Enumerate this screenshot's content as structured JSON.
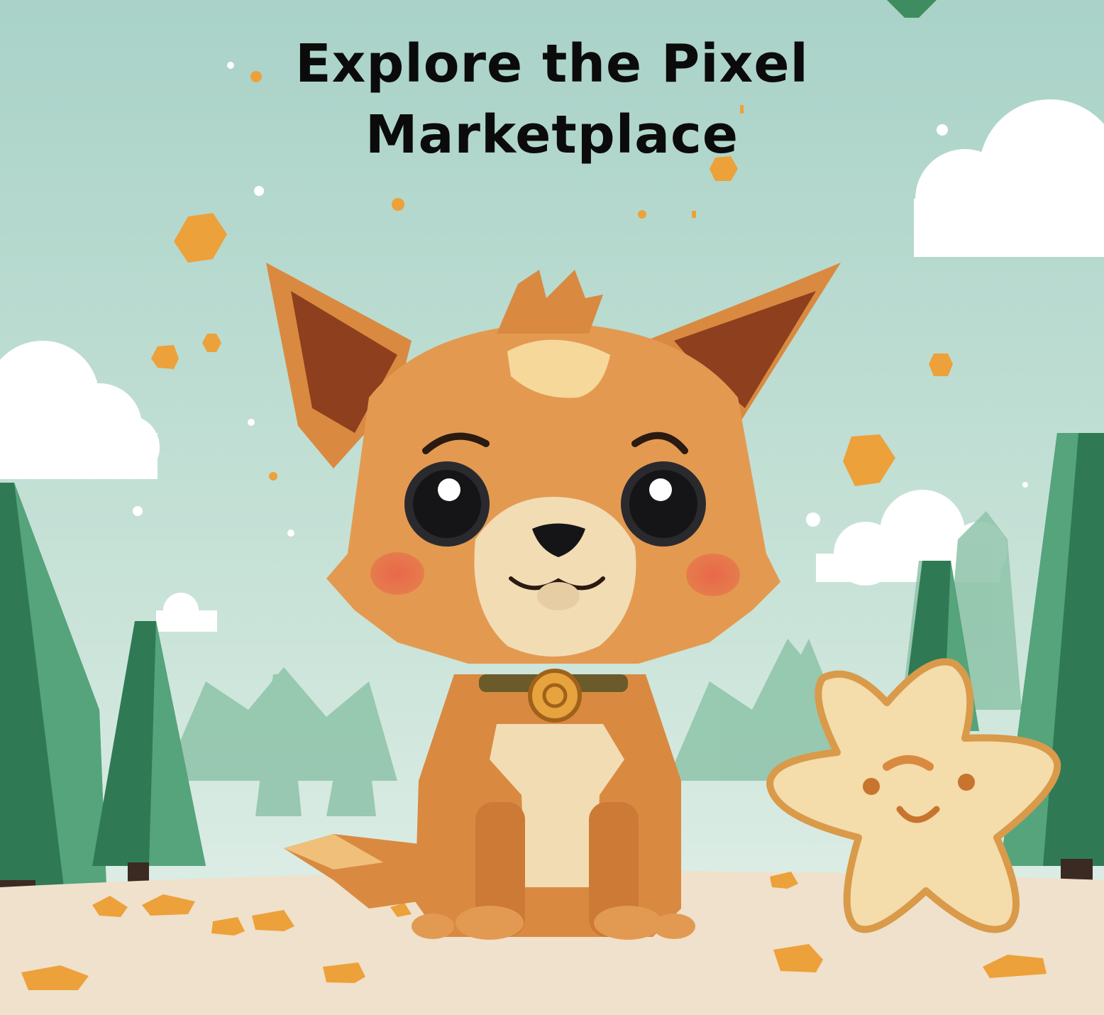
{
  "headline": {
    "line1": "Explore the Pixel",
    "line2": "Marketplace"
  },
  "scene": {
    "characters": [
      "fox-pup",
      "star-cookie"
    ],
    "colors": {
      "sky_top": "#a9d2c8",
      "sky_bottom": "#e4f1ea",
      "tree_dark": "#2f7a55",
      "tree_light": "#55a47c",
      "mountain": "#8ec3a9",
      "ground": "#efe1cb",
      "fox_fur": "#d98a40",
      "fox_inner_ear": "#8e3f1e",
      "fox_cream": "#f2dcb4",
      "cookie": "#f4dcab",
      "cookie_edge": "#d99a4a",
      "gem": "#eda13a",
      "cloud": "#ffffff"
    }
  }
}
